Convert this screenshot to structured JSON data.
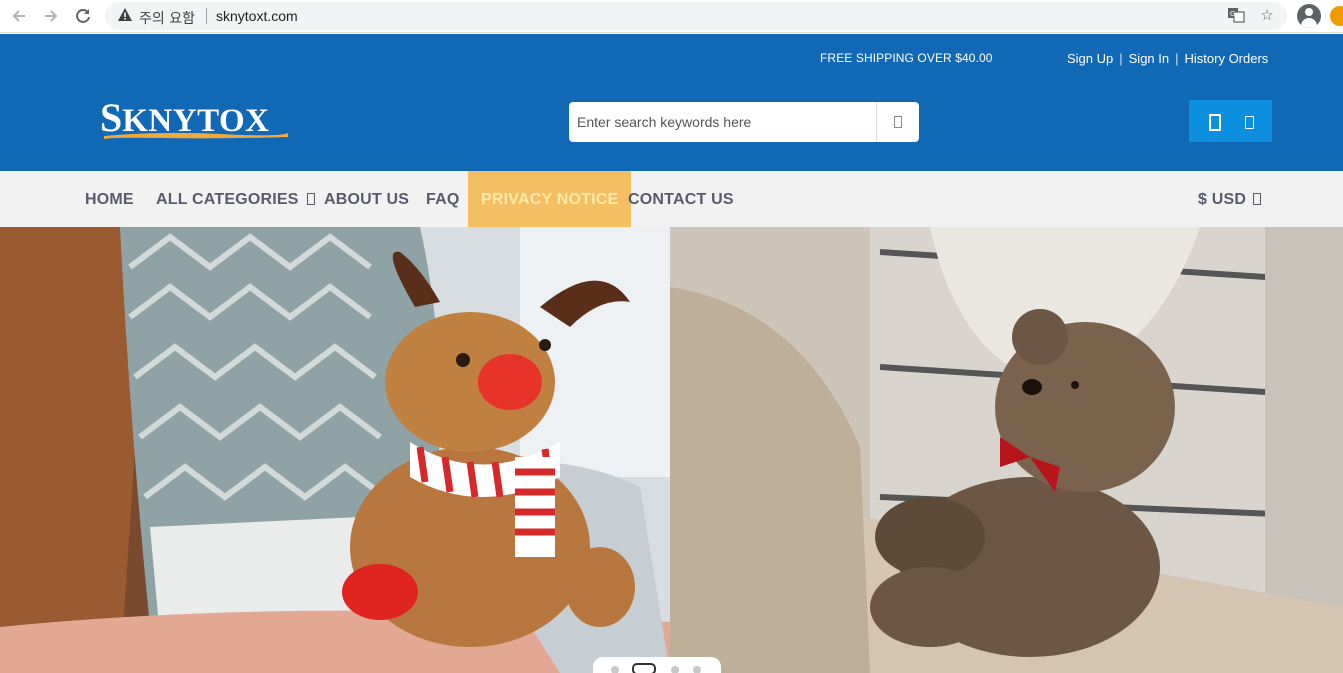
{
  "browser": {
    "security_label": "주의 요함",
    "url": "sknytoxt.com",
    "icons": [
      "back-icon",
      "forward-icon",
      "reload-icon",
      "warning-icon",
      "translate-icon",
      "star-icon",
      "profile-icon"
    ]
  },
  "header": {
    "shipping_text": "FREE SHIPPING OVER $40.00",
    "links": {
      "sign_up": "Sign Up",
      "sign_in": "Sign In",
      "history_orders": "History Orders"
    },
    "logo_text": "SKNYTOX",
    "search": {
      "placeholder": "Enter search keywords here"
    },
    "colors": {
      "header_bg": "#1169b6",
      "cart_bg": "#0b8fde",
      "accent": "#f3bf62"
    }
  },
  "nav": {
    "home": "HOME",
    "all_categories": "ALL CATEGORIES",
    "about_us": "ABOUT US",
    "faq": "FAQ",
    "privacy_notice": "PRIVACY NOTICE",
    "contact_us": "CONTACT US",
    "currency": "$ USD"
  },
  "hero": {
    "slides": [
      "reindeer-plush-photo",
      "teddy-bear-photo"
    ],
    "pager_count": 4,
    "active_slide": 1
  }
}
